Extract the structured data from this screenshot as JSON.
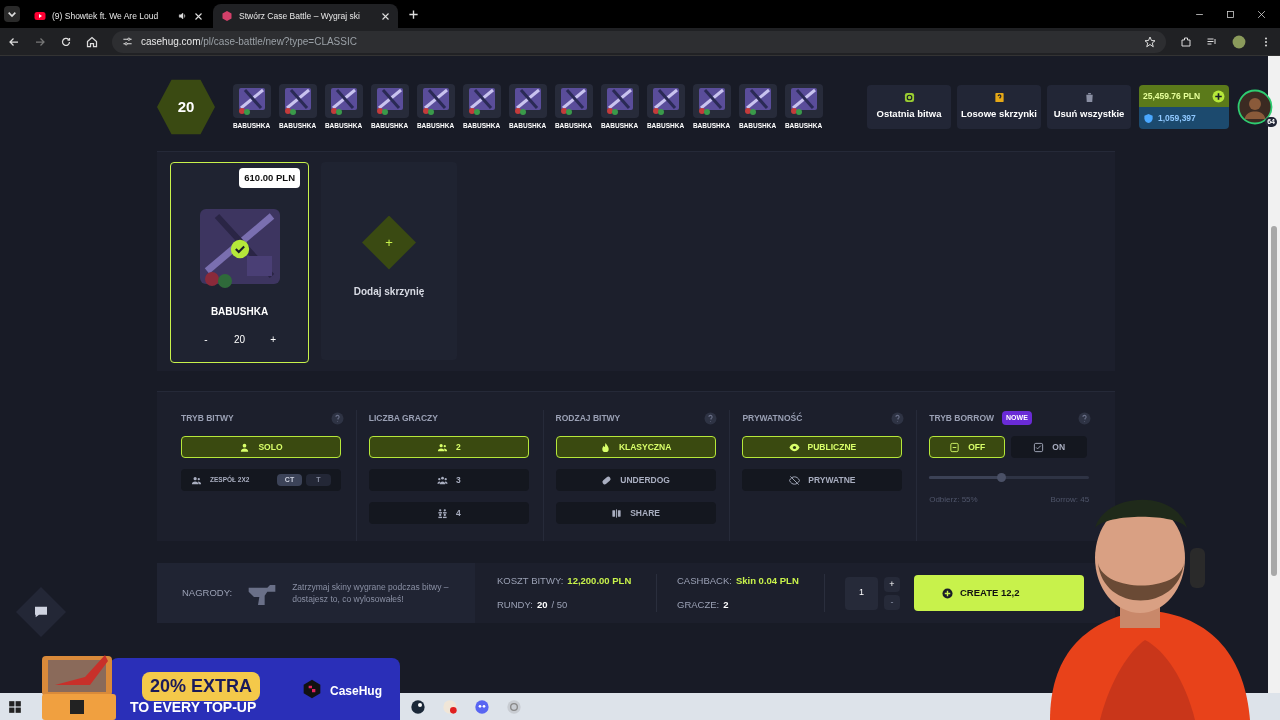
{
  "browser": {
    "tabs": [
      {
        "title": "(9) Showtek ft. We Are Loud",
        "selected": false,
        "kind": "video"
      },
      {
        "title": "Stwórz Case Battle – Wygraj ski",
        "selected": true,
        "kind": "site"
      }
    ],
    "url_host": "casehug.com",
    "url_path": "/pl/case-battle/new?type=CLASSIC"
  },
  "strip": {
    "count": "20",
    "cases": [
      {
        "name": "BABUSHKA"
      },
      {
        "name": "BABUSHKA"
      },
      {
        "name": "BABUSHKA"
      },
      {
        "name": "BABUSHKA"
      },
      {
        "name": "BABUSHKA"
      },
      {
        "name": "BABUSHKA"
      },
      {
        "name": "BABUSHKA"
      },
      {
        "name": "BABUSHKA"
      },
      {
        "name": "BABUSHKA"
      },
      {
        "name": "BABUSHKA"
      },
      {
        "name": "BABUSHKA"
      },
      {
        "name": "BABUSHKA"
      },
      {
        "name": "BABUSHKA"
      }
    ],
    "actions": [
      {
        "label": "Ostatnia bitwa",
        "kind": "last"
      },
      {
        "label": "Losowe skrzynki",
        "kind": "random"
      },
      {
        "label": "Usuń wszystkie",
        "kind": "delete"
      }
    ],
    "balance": "25,459.76 PLN",
    "coins": "1,059,397",
    "level": "64"
  },
  "selected_case": {
    "price": "610.00 PLN",
    "name": "BABUSHKA",
    "checked": true,
    "minus": "-",
    "quantity": "20",
    "plus": "+"
  },
  "add_case": {
    "icon": "+",
    "label": "Dodaj skrzynię"
  },
  "settings": [
    {
      "title": "TRYB BITWY",
      "options": [
        {
          "label": "SOLO",
          "selected": true
        },
        {
          "label": "ZESPÓŁ 2X2",
          "selected": false,
          "sides": [
            {
              "label": "CT",
              "selected": true
            },
            {
              "label": "T",
              "selected": false
            }
          ]
        }
      ]
    },
    {
      "title": "LICZBA GRACZY",
      "options": [
        {
          "label": "2",
          "selected": true
        },
        {
          "label": "3",
          "selected": false
        },
        {
          "label": "4",
          "selected": false
        }
      ]
    },
    {
      "title": "RODZAJ BITWY",
      "options": [
        {
          "label": "KLASYCZNA",
          "selected": true
        },
        {
          "label": "UNDERDOG",
          "selected": false
        },
        {
          "label": "SHARE",
          "selected": false
        }
      ]
    },
    {
      "title": "PRYWATNOŚĆ",
      "options": [
        {
          "label": "PUBLICZNE",
          "selected": true
        },
        {
          "label": "PRYWATNE",
          "selected": false
        }
      ]
    },
    {
      "title": "TRYB BORROW",
      "badge": "NOWE",
      "options": [
        {
          "label": "OFF",
          "selected": true
        },
        {
          "label": "ON",
          "selected": false
        }
      ],
      "slider": {
        "level": 0.45,
        "left": "Odbierz: 55%",
        "right": "Borrow: 45"
      }
    }
  ],
  "footer": {
    "rewards_label": "NAGRODY:",
    "rewards_text": "Zatrzymaj skiny wygrane podczas bitwy – dostajesz to, co wylosowałeś!",
    "cost_label": "KOSZT BITWY:",
    "cost": "12,200.00 PLN",
    "rounds_label": "RUNDY:",
    "rounds": "20",
    "rounds_total": "/ 50",
    "cashback_label": "CASHBACK:",
    "cashback": "Skin 0.04 PLN",
    "players_label": "GRACZE:",
    "players": "2",
    "quantity": "1",
    "plus": "+",
    "minus": "-",
    "create": "CREATE 12,2"
  },
  "banner": {
    "headline": "20% EXTRA",
    "subline": "TO EVERY TOP-UP",
    "brand": "CaseHug"
  }
}
